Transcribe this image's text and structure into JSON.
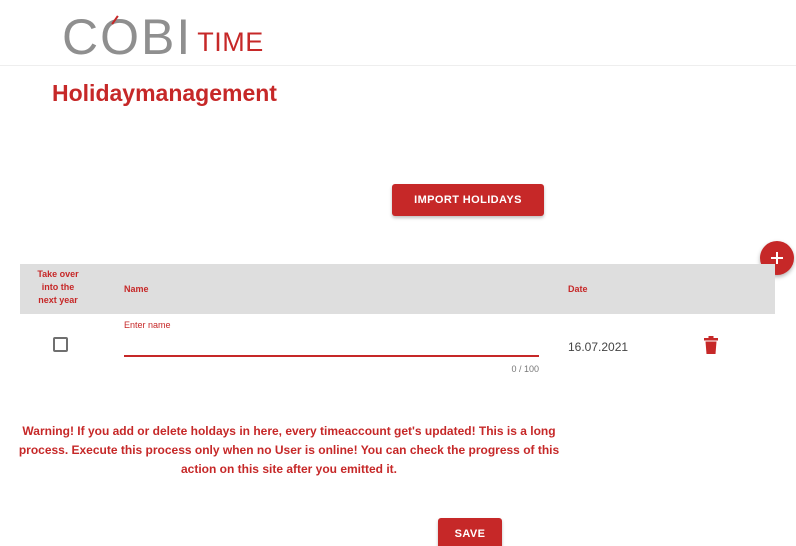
{
  "brand": {
    "logo_main": "COBI",
    "logo_sub": "TIME",
    "accent_color": "#c62828"
  },
  "page": {
    "title": "Holidaymanagement"
  },
  "actions": {
    "import_label": "IMPORT HOLIDAYS",
    "add_icon": "plus-icon",
    "save_label": "SAVE"
  },
  "table": {
    "columns": {
      "takeover": "Take over into the next year",
      "name": "Name",
      "date": "Date"
    },
    "rows": [
      {
        "takeover_checked": false,
        "name_label": "Enter name",
        "name_value": "",
        "name_counter": "0 / 100",
        "date": "16.07.2021",
        "delete_icon": "trash-icon"
      }
    ]
  },
  "warning": {
    "text": "Warning! If you add or delete holdays in here, every timeaccount get's updated! This is a long process. Execute this process only when no User is online! You can check the progress of this action on this site after you emitted it."
  }
}
